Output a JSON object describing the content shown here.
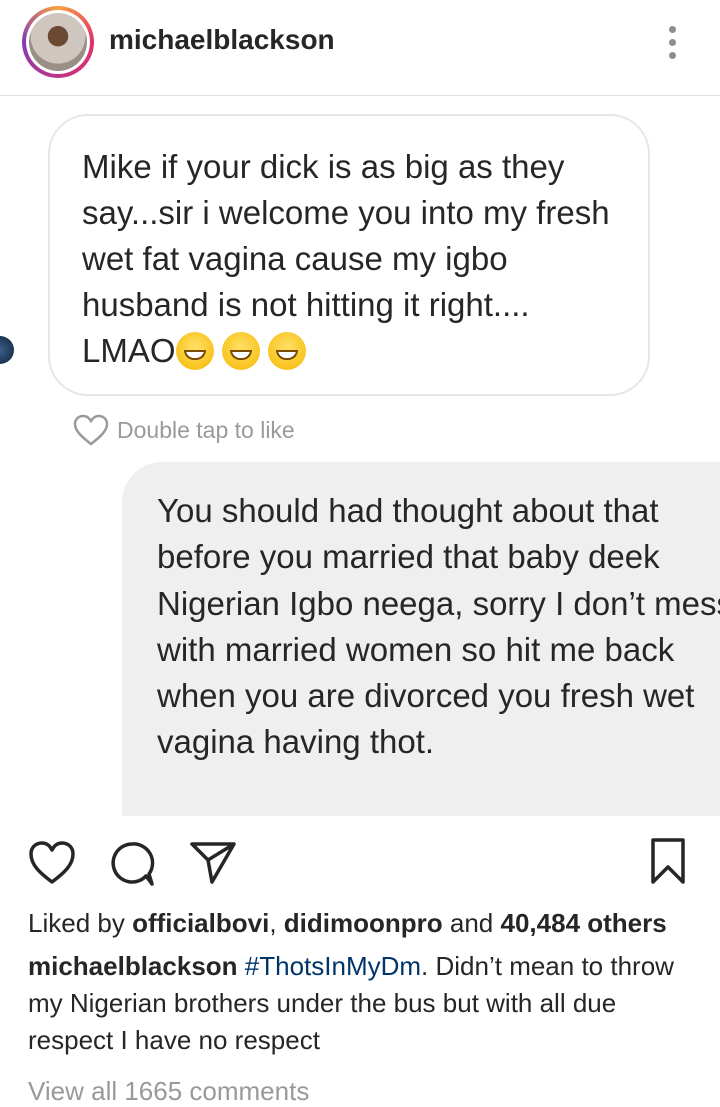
{
  "header": {
    "username": "michaelblackson"
  },
  "post": {
    "incoming_message": "Mike if your dick is as big as they say...sir i welcome you into my fresh wet fat vagina cause my igbo husband is not hitting it right.... LMAO",
    "emoji_count": 3,
    "like_hint": "Double tap to like",
    "outgoing_message": "You should had thought about that before you married that baby deek Nigerian Igbo neega, sorry I don’t mess with married women so hit me back when you are divorced you fresh wet vagina having thot."
  },
  "actions": {
    "icons": [
      "heart-icon",
      "comment-icon",
      "share-icon",
      "bookmark-icon"
    ]
  },
  "likes": {
    "prefix": "Liked by",
    "user1": "officialbovi",
    "separator": ",",
    "user2": "didimoonpro",
    "and": "and",
    "others": "40,484 others"
  },
  "caption": {
    "author": "michaelblackson",
    "hashtag": "#ThotsInMyDm",
    "text": ". Didn’t mean to throw my Nigerian brothers under the bus but with all due respect I have no respect"
  },
  "comments": {
    "view_all": "View all 1665 comments"
  }
}
